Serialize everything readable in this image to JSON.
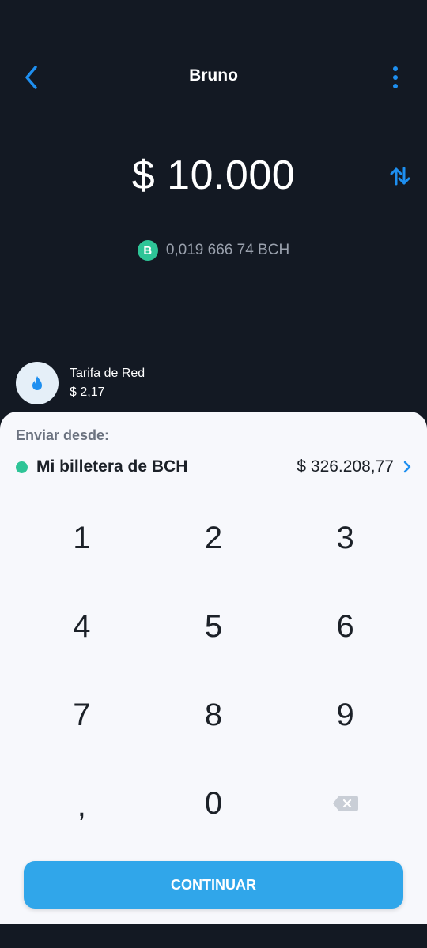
{
  "header": {
    "title": "Bruno",
    "back_icon": "chevron-left-icon",
    "more_icon": "more-vertical-icon"
  },
  "amount": {
    "fiat": "$ 10.000",
    "crypto": "0,019 666 74 BCH",
    "coin_symbol": "B",
    "swap_icon": "swap-arrows-icon"
  },
  "fee": {
    "label": "Tarifa de Red",
    "value": "$ 2,17",
    "icon": "flame-icon"
  },
  "send_from": {
    "label": "Enviar desde:",
    "wallet_name": "Mi billetera de BCH",
    "wallet_balance": "$ 326.208,77",
    "chevron_icon": "chevron-right-icon"
  },
  "keypad": {
    "keys": [
      "1",
      "2",
      "3",
      "4",
      "5",
      "6",
      "7",
      "8",
      "9",
      ",",
      "0"
    ],
    "backspace_icon": "backspace-icon"
  },
  "continue_label": "CONTINUAR",
  "colors": {
    "accent": "#1e8ff0",
    "bch": "#2ec497",
    "background": "#131923",
    "sheet": "#f7f8fc",
    "button": "#30a6ea"
  }
}
